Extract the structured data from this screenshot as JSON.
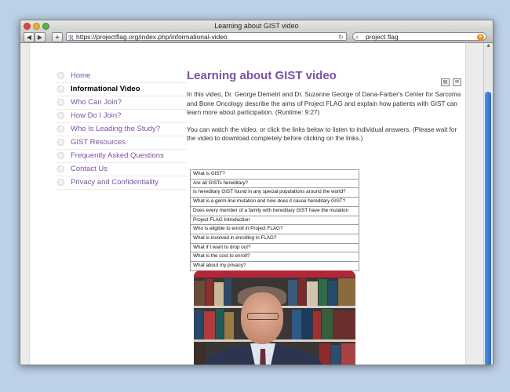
{
  "window": {
    "title": "Learning about GIST video"
  },
  "toolbar": {
    "back_glyph": "◀",
    "forward_glyph": "▶",
    "add_glyph": "+",
    "favicon_glyph": "ℜ",
    "reload_glyph": "↻",
    "url": "https://projectflag.org/index.php/informational-video",
    "search_glyph": "⌕",
    "search_value": "project flag",
    "search_go_glyph": "⊛"
  },
  "sidebar": {
    "items": [
      {
        "label": "Home"
      },
      {
        "label": "Informational Video"
      },
      {
        "label": "Who Can Join?"
      },
      {
        "label": "How Do I Join?"
      },
      {
        "label": "Who Is Leading the Study?"
      },
      {
        "label": "GIST Resources"
      },
      {
        "label": "Frequently Asked Questions"
      },
      {
        "label": "Contact Us"
      },
      {
        "label": "Privacy and Confidentiality"
      }
    ],
    "active_index": 1
  },
  "main": {
    "heading": "Learning about GIST video",
    "intro": "In this video, Dr. George Demetri and Dr. Suzanne George of Dana-Farber's Center for Sarcoma and Bone Oncology describe the aims of Project FLAG and explain how patients with GIST can learn more about participation. (Runtime: 9:27)",
    "instructions": "You can watch the video, or click the links below to listen to individual answers. (Please wait for the video to download completely before clicking on the links.)",
    "links": [
      "What is GIST?",
      "Are all GISTs hereditary?",
      "Is hereditary GIST found in any special populations around the world?",
      "What is a germ-line mutation and how does it cause hereditary GIST?",
      "Does every member of a family with hereditary GIST have the mutation",
      "Project FLAG Introduction",
      "Who is eligible to enroll in Project FLAG?",
      "What is involved in enrolling in FLAG?",
      "What if I want to drop out?",
      "What is the cost to enroll?",
      "What about my privacy?"
    ]
  },
  "colors": {
    "accent": "#7d50a3",
    "video_band": "#b3263a",
    "scroll_thumb": "#2e6cc9"
  }
}
